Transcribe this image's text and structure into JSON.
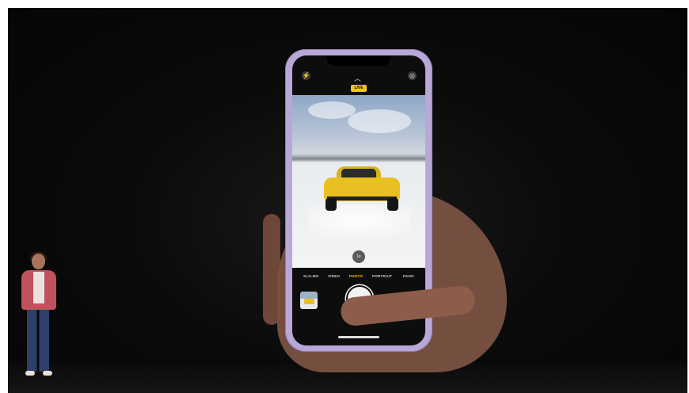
{
  "camera": {
    "live_badge": "LIVE",
    "zoom_label": "1x",
    "modes": [
      {
        "label": "SLO-MO",
        "active": false
      },
      {
        "label": "VIDEO",
        "active": false
      },
      {
        "label": "PHOTO",
        "active": true
      },
      {
        "label": "PORTRAIT",
        "active": false
      },
      {
        "label": "PANO",
        "active": false
      }
    ]
  },
  "colors": {
    "accent": "#f5c900",
    "phone_frame": "#b9a7d8",
    "presenter_jacket": "#c0525d"
  },
  "icons": [
    "flash-icon",
    "chevron-up-icon",
    "settings-icon",
    "flip-camera-icon"
  ]
}
